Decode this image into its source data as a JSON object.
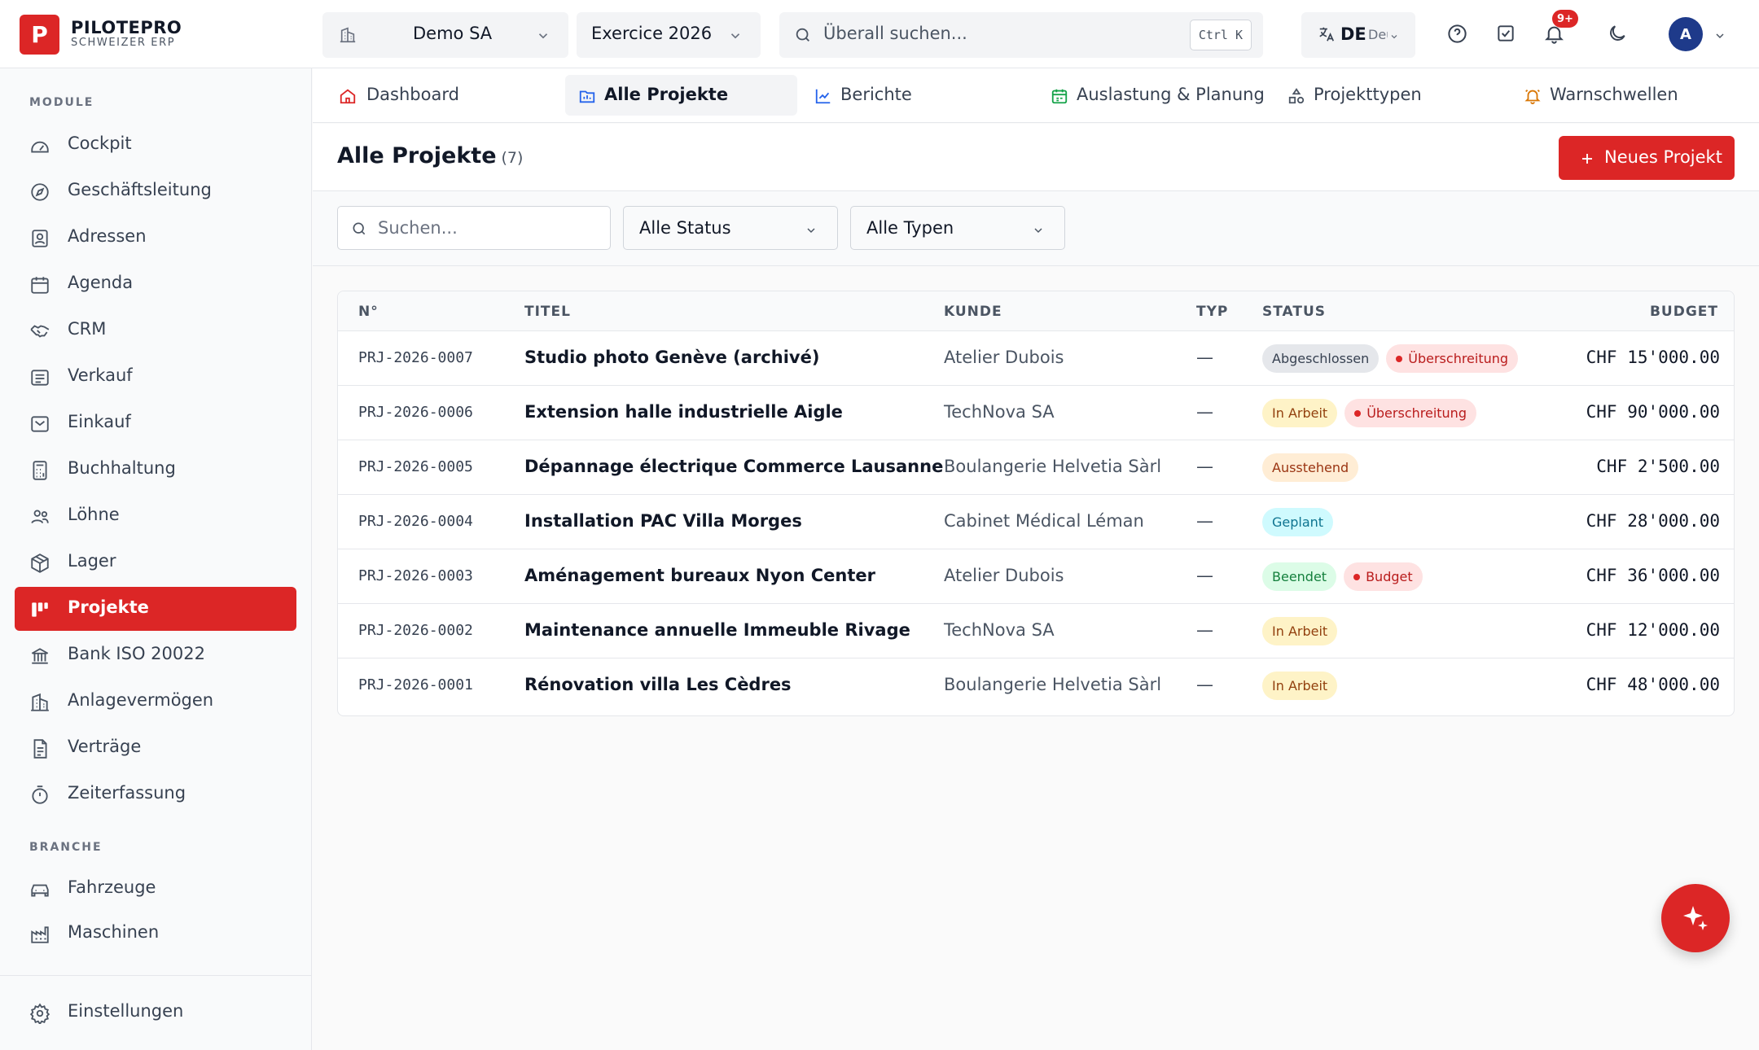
{
  "brand": {
    "logo_letter": "P",
    "name": "PILOTEPRO",
    "subtitle": "SCHWEIZER ERP"
  },
  "topbar": {
    "company": "Demo SA",
    "fiscal_year": "Exercice 2026",
    "search_placeholder": "Überall suchen...",
    "search_shortcut": "Ctrl K",
    "lang_code": "DE",
    "lang_name": "Deutsch",
    "notif_count": "9+",
    "avatar_initial": "A",
    "icons": [
      "building-icon",
      "chevron-down-icon",
      "search-icon",
      "translate-icon",
      "help-icon",
      "tasks-icon",
      "bell-icon",
      "moon-icon"
    ]
  },
  "sidebar": {
    "section_modules": "MODULE",
    "section_branche": "BRANCHE",
    "modules": [
      {
        "label": "Cockpit",
        "icon": "gauge-icon"
      },
      {
        "label": "Geschäftsleitung",
        "icon": "compass-icon"
      },
      {
        "label": "Adressen",
        "icon": "contact-icon"
      },
      {
        "label": "Agenda",
        "icon": "calendar-icon"
      },
      {
        "label": "CRM",
        "icon": "handshake-icon"
      },
      {
        "label": "Verkauf",
        "icon": "receipt-icon"
      },
      {
        "label": "Einkauf",
        "icon": "inbox-icon"
      },
      {
        "label": "Buchhaltung",
        "icon": "calculator-icon"
      },
      {
        "label": "Löhne",
        "icon": "users-icon"
      },
      {
        "label": "Lager",
        "icon": "package-icon"
      },
      {
        "label": "Projekte",
        "icon": "kanban-icon",
        "active": true
      },
      {
        "label": "Bank ISO 20022",
        "icon": "bank-icon"
      },
      {
        "label": "Anlagevermögen",
        "icon": "building-icon"
      },
      {
        "label": "Verträge",
        "icon": "document-icon"
      },
      {
        "label": "Zeiterfassung",
        "icon": "timer-icon"
      }
    ],
    "branche": [
      {
        "label": "Fahrzeuge",
        "icon": "car-icon"
      },
      {
        "label": "Maschinen",
        "icon": "factory-icon"
      }
    ],
    "settings": "Einstellungen"
  },
  "tabs": [
    {
      "label": "Dashboard",
      "icon": "home-icon"
    },
    {
      "label": "Alle Projekte",
      "icon": "folder-icon",
      "active": true
    },
    {
      "label": "Berichte",
      "icon": "line-chart-icon"
    },
    {
      "label": "Auslastung & Planung",
      "icon": "calendar-check-icon"
    },
    {
      "label": "Projekttypen",
      "icon": "shapes-icon"
    },
    {
      "label": "Warnschwellen",
      "icon": "bell-warning-icon"
    }
  ],
  "page": {
    "title": "Alle Projekte",
    "count": "(7)",
    "new_button": "Neues Projekt"
  },
  "filters": {
    "search_placeholder": "Suchen...",
    "status": "Alle Status",
    "type": "Alle Typen"
  },
  "table": {
    "columns": [
      "N°",
      "TITEL",
      "KUNDE",
      "TYP",
      "STATUS",
      "BUDGET"
    ],
    "rows": [
      {
        "nr": "PRJ-2026-0007",
        "title": "Studio photo Genève (archivé)",
        "kunde": "Atelier Dubois",
        "typ": "—",
        "badges": [
          {
            "text": "Abgeschlossen",
            "style": "gray"
          },
          {
            "text": "Überschreitung",
            "style": "red",
            "dot": true
          }
        ],
        "budget": "CHF 15'000.00"
      },
      {
        "nr": "PRJ-2026-0006",
        "title": "Extension halle industrielle Aigle",
        "kunde": "TechNova SA",
        "typ": "—",
        "badges": [
          {
            "text": "In Arbeit",
            "style": "amber"
          },
          {
            "text": "Überschreitung",
            "style": "red",
            "dot": true
          }
        ],
        "budget": "CHF 90'000.00"
      },
      {
        "nr": "PRJ-2026-0005",
        "title": "Dépannage électrique Commerce Lausanne",
        "kunde": "Boulangerie Helvetia Sàrl",
        "typ": "—",
        "badges": [
          {
            "text": "Ausstehend",
            "style": "orange"
          }
        ],
        "budget": "CHF 2'500.00"
      },
      {
        "nr": "PRJ-2026-0004",
        "title": "Installation PAC Villa Morges",
        "kunde": "Cabinet Médical Léman",
        "typ": "—",
        "badges": [
          {
            "text": "Geplant",
            "style": "cyan"
          }
        ],
        "budget": "CHF 28'000.00"
      },
      {
        "nr": "PRJ-2026-0003",
        "title": "Aménagement bureaux Nyon Center",
        "kunde": "Atelier Dubois",
        "typ": "—",
        "badges": [
          {
            "text": "Beendet",
            "style": "green"
          },
          {
            "text": "Budget",
            "style": "red",
            "dot": true
          }
        ],
        "budget": "CHF 36'000.00"
      },
      {
        "nr": "PRJ-2026-0002",
        "title": "Maintenance annuelle Immeuble Rivage",
        "kunde": "TechNova SA",
        "typ": "—",
        "badges": [
          {
            "text": "In Arbeit",
            "style": "amber"
          }
        ],
        "budget": "CHF 12'000.00"
      },
      {
        "nr": "PRJ-2026-0001",
        "title": "Rénovation villa Les Cèdres",
        "kunde": "Boulangerie Helvetia Sàrl",
        "typ": "—",
        "badges": [
          {
            "text": "In Arbeit",
            "style": "amber"
          }
        ],
        "budget": "CHF 48'000.00"
      }
    ]
  },
  "colors": {
    "accent": "#dc2626",
    "avatar": "#1e3a8a"
  }
}
